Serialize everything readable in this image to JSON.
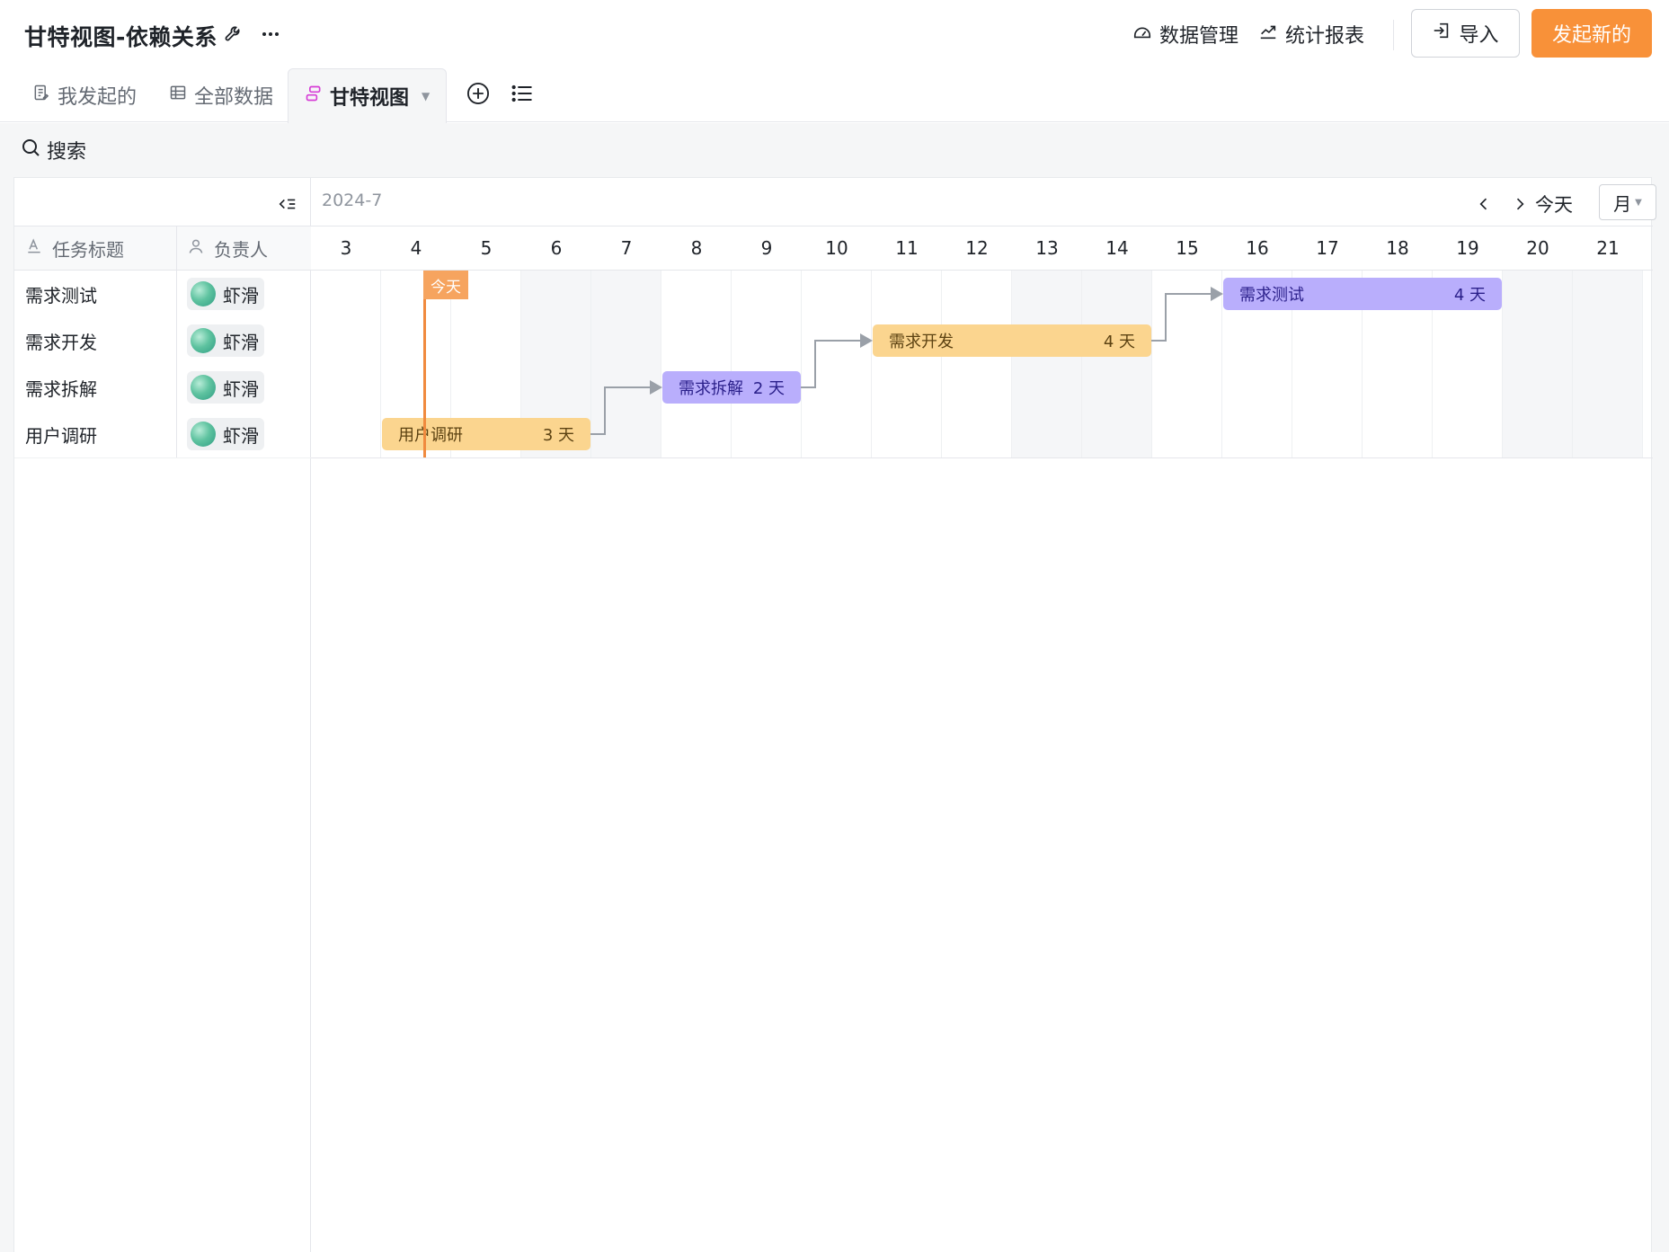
{
  "header": {
    "title": "甘特视图-依赖关系",
    "data_manage": "数据管理",
    "stats_report": "统计报表",
    "import_label": "导入",
    "new_label": "发起新的"
  },
  "tabs": [
    {
      "label": "我发起的",
      "icon": "form-doc-icon"
    },
    {
      "label": "全部数据",
      "icon": "table-grid-icon"
    },
    {
      "label": "甘特视图",
      "icon": "gantt-icon",
      "active": true
    }
  ],
  "toolbar": {
    "search_label": "搜索"
  },
  "gantt": {
    "month": "2024-7",
    "today_label": "今天",
    "scale": "月",
    "columns": {
      "title": "任务标题",
      "owner": "负责人"
    },
    "days": [
      "3",
      "4",
      "5",
      "6",
      "7",
      "8",
      "9",
      "10",
      "11",
      "12",
      "13",
      "14",
      "15",
      "16",
      "17",
      "18",
      "19",
      "20",
      "21"
    ],
    "weekend_days": [
      "6",
      "7",
      "13",
      "14",
      "20",
      "21"
    ],
    "today": "4",
    "tasks": [
      {
        "title": "需求测试",
        "owner": "虾滑",
        "bar_label": "需求测试",
        "start": "16",
        "end": "19",
        "duration": "4 天",
        "color": "#b9aefc"
      },
      {
        "title": "需求开发",
        "owner": "虾滑",
        "bar_label": "需求开发",
        "start": "11",
        "end": "14",
        "duration": "4 天",
        "color": "#fbd58f"
      },
      {
        "title": "需求拆解",
        "owner": "虾滑",
        "bar_label": "需求拆解",
        "start": "8",
        "end": "9",
        "duration": "2 天",
        "color": "#b9aefc"
      },
      {
        "title": "用户调研",
        "owner": "虾滑",
        "bar_label": "用户调研",
        "start": "4",
        "end": "6",
        "duration": "3 天",
        "color": "#fbd58f"
      }
    ]
  },
  "colors": {
    "accent": "#f89139",
    "today_line": "#f08a3e",
    "bar_orange": "#fbd58f",
    "bar_purple": "#b9aefc"
  }
}
